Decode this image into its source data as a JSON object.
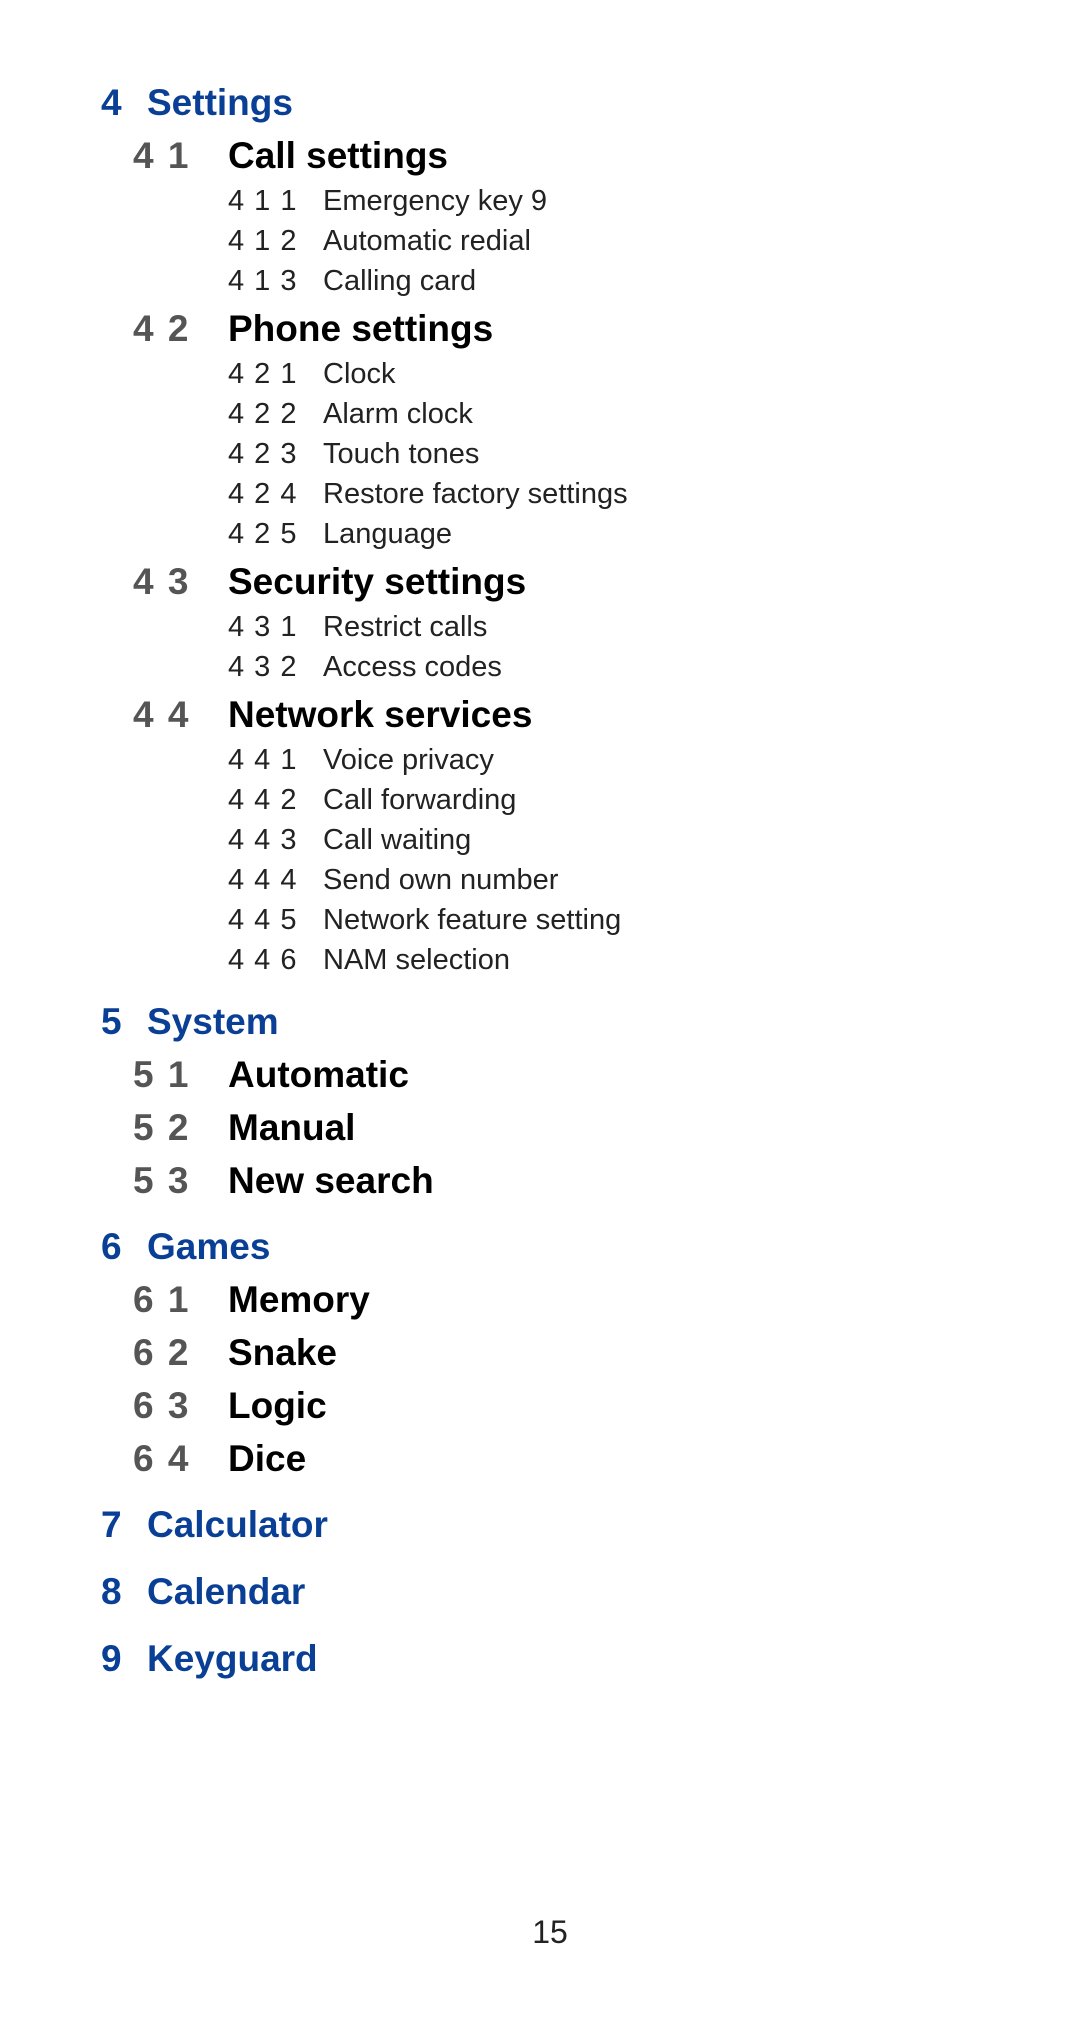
{
  "sections": [
    {
      "num": "4",
      "title": "Settings",
      "subs": [
        {
          "num": "4 1",
          "title": "Call settings",
          "items": [
            {
              "num": "4 1 1",
              "label": "Emergency key 9"
            },
            {
              "num": "4 1 2",
              "label": "Automatic redial"
            },
            {
              "num": "4 1 3",
              "label": "Calling card"
            }
          ]
        },
        {
          "num": "4 2",
          "title": "Phone settings",
          "items": [
            {
              "num": "4 2 1",
              "label": "Clock"
            },
            {
              "num": "4 2 2",
              "label": "Alarm clock"
            },
            {
              "num": "4 2 3",
              "label": "Touch tones"
            },
            {
              "num": "4 2 4",
              "label": "Restore factory settings"
            },
            {
              "num": "4 2 5",
              "label": "Language"
            }
          ]
        },
        {
          "num": "4 3",
          "title": "Security settings",
          "items": [
            {
              "num": "4 3 1",
              "label": "Restrict calls"
            },
            {
              "num": "4 3 2",
              "label": "Access codes"
            }
          ]
        },
        {
          "num": "4 4",
          "title": "Network services",
          "items": [
            {
              "num": "4 4 1",
              "label": "Voice privacy"
            },
            {
              "num": "4 4 2",
              "label": "Call forwarding"
            },
            {
              "num": "4 4 3",
              "label": "Call waiting"
            },
            {
              "num": "4 4 4",
              "label": "Send own number"
            },
            {
              "num": "4 4 5",
              "label": "Network feature setting"
            },
            {
              "num": "4 4 6",
              "label": "NAM selection"
            }
          ]
        }
      ]
    },
    {
      "num": "5",
      "title": "System",
      "subs": [
        {
          "num": "5 1",
          "title": "Automatic"
        },
        {
          "num": "5 2",
          "title": "Manual"
        },
        {
          "num": "5 3",
          "title": "New search"
        }
      ]
    },
    {
      "num": "6",
      "title": "Games",
      "subs": [
        {
          "num": "6 1",
          "title": "Memory"
        },
        {
          "num": "6 2",
          "title": "Snake"
        },
        {
          "num": "6 3",
          "title": "Logic"
        },
        {
          "num": "6 4",
          "title": "Dice"
        }
      ]
    },
    {
      "num": "7",
      "title": "Calculator"
    },
    {
      "num": "8",
      "title": "Calendar"
    },
    {
      "num": "9",
      "title": "Keyguard"
    }
  ],
  "page_number": "15",
  "colors": {
    "heading_blue": "#0a3f96",
    "subheading_number_gray": "#555555"
  }
}
